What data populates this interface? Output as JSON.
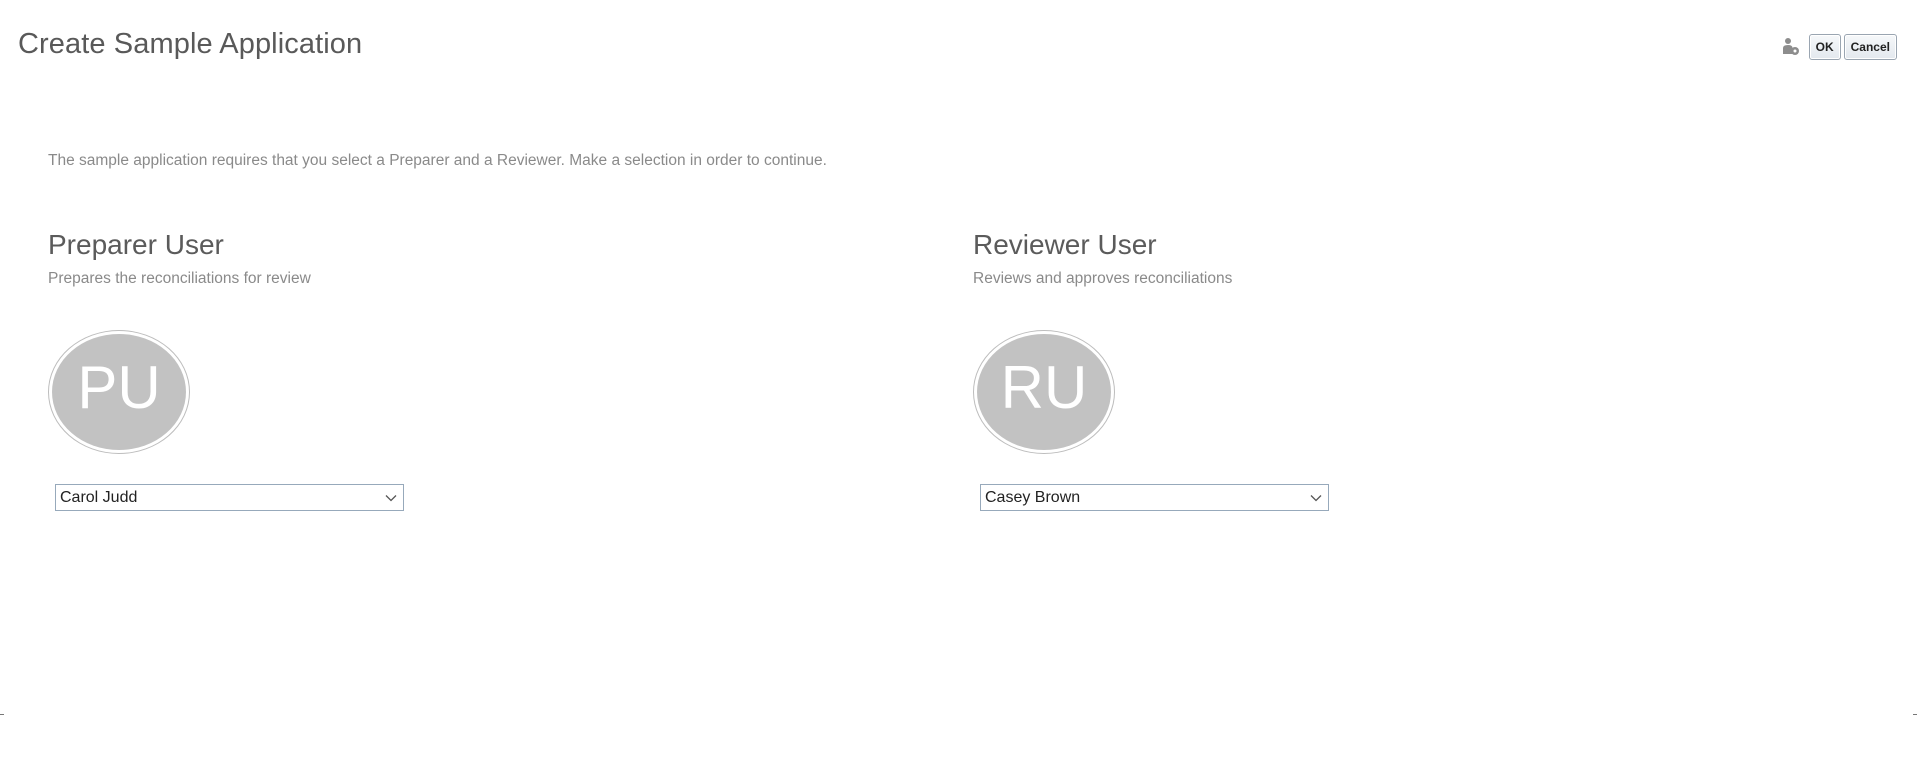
{
  "header": {
    "title": "Create Sample Application",
    "ok_label": "OK",
    "cancel_label": "Cancel",
    "user_icon": "user-settings-icon"
  },
  "instructions": "The sample application requires that you select a Preparer and a Reviewer. Make a selection in order to continue.",
  "preparer": {
    "heading": "Preparer User",
    "subtitle": "Prepares the reconciliations for review",
    "initials": "PU",
    "selected_user": "Carol Judd"
  },
  "reviewer": {
    "heading": "Reviewer User",
    "subtitle": "Reviews and approves reconciliations",
    "initials": "RU",
    "selected_user": "Casey Brown"
  },
  "colors": {
    "avatar_fill": "#c2c2c2",
    "title_text": "#595959",
    "muted_text": "#8a8a8a",
    "select_border": "#97a9bb"
  }
}
